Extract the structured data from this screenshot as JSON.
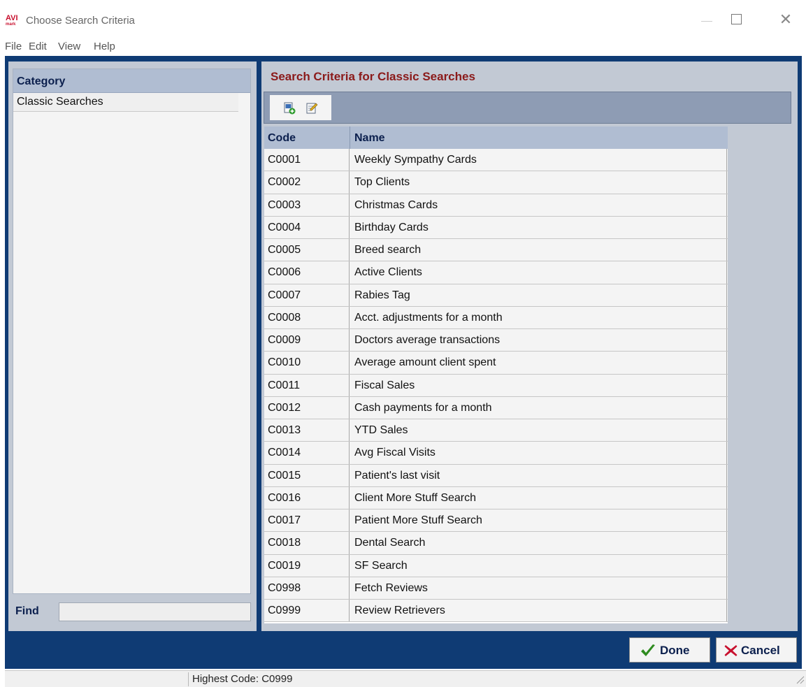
{
  "window": {
    "logo_text": "AVI",
    "logo_subtext": "mark",
    "title": "Choose Search Criteria",
    "controls": [
      "minimize",
      "maximize",
      "close"
    ]
  },
  "menu": [
    "File",
    "Edit",
    "View",
    "Help"
  ],
  "category_panel": {
    "header": "Category",
    "items": [
      {
        "label": "Classic Searches",
        "selected": true
      }
    ],
    "find_label": "Find",
    "find_value": ""
  },
  "criteria_panel": {
    "title": "Search Criteria for Classic Searches",
    "toolbar": [
      {
        "icon": "new-record-icon"
      },
      {
        "icon": "edit-record-icon"
      }
    ],
    "columns": [
      "Code",
      "Name"
    ],
    "rows": [
      {
        "code": "C0001",
        "name": "Weekly Sympathy Cards"
      },
      {
        "code": "C0002",
        "name": "Top Clients"
      },
      {
        "code": "C0003",
        "name": "Christmas Cards"
      },
      {
        "code": "C0004",
        "name": "Birthday Cards"
      },
      {
        "code": "C0005",
        "name": "Breed search"
      },
      {
        "code": "C0006",
        "name": "Active Clients"
      },
      {
        "code": "C0007",
        "name": "Rabies Tag"
      },
      {
        "code": "C0008",
        "name": "Acct. adjustments for a month"
      },
      {
        "code": "C0009",
        "name": "Doctors average transactions"
      },
      {
        "code": "C0010",
        "name": "Average amount client spent"
      },
      {
        "code": "C0011",
        "name": "Fiscal Sales"
      },
      {
        "code": "C0012",
        "name": "Cash payments for a month"
      },
      {
        "code": "C0013",
        "name": "YTD Sales"
      },
      {
        "code": "C0014",
        "name": "Avg Fiscal Visits"
      },
      {
        "code": "C0015",
        "name": "Patient's last visit"
      },
      {
        "code": "C0016",
        "name": "Client More Stuff Search"
      },
      {
        "code": "C0017",
        "name": "Patient More Stuff Search"
      },
      {
        "code": "C0018",
        "name": "Dental Search"
      },
      {
        "code": "C0019",
        "name": "SF Search"
      },
      {
        "code": "C0998",
        "name": "Fetch Reviews"
      },
      {
        "code": "C0999",
        "name": "Review Retrievers"
      }
    ]
  },
  "buttons": {
    "done": "Done",
    "cancel": "Cancel"
  },
  "status": {
    "text": "Highest Code: C0999"
  },
  "colors": {
    "frame": "#0f3b74",
    "panel": "#c2c9d4",
    "header": "#b0bdd2",
    "title_red": "#8b1a1a",
    "done_check": "#2e8b1f",
    "cancel_x": "#c8102e"
  }
}
